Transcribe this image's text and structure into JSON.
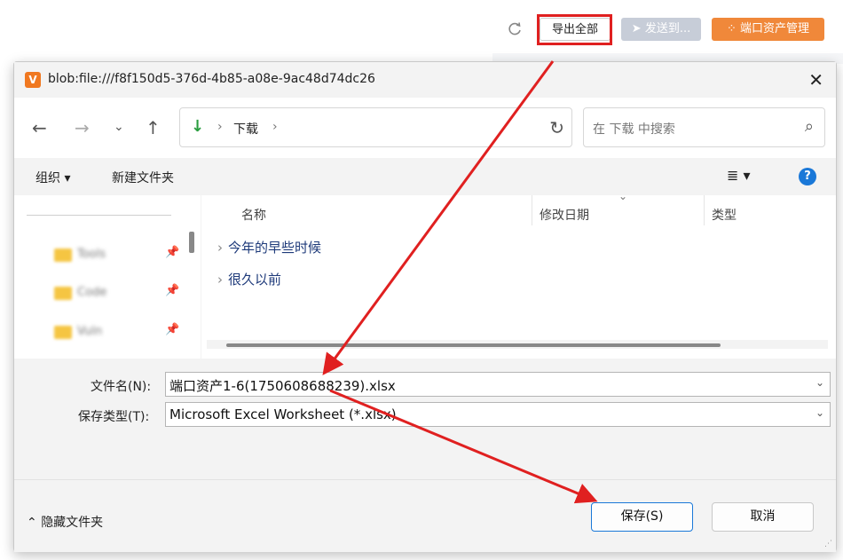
{
  "toolbar": {
    "export_all": "导出全部",
    "send_to": "发送到...",
    "port_asset_mgmt": "端口资产管理"
  },
  "dialog": {
    "title": "blob:file:///f8f150d5-376d-4b85-a08e-9ac48d74dc26",
    "breadcrumb": "下载",
    "search_placeholder": "在 下载 中搜索",
    "commands": {
      "organize": "组织 ▾",
      "new_folder": "新建文件夹"
    },
    "columns": {
      "name": "名称",
      "date": "修改日期",
      "type": "类型"
    },
    "groups": [
      "今年的早些时候",
      "很久以前"
    ],
    "quick_access": [
      "Tools",
      "Code",
      "Vuln"
    ],
    "filename_label": "文件名(N):",
    "filename_value": "端口资产1-6(1750608688239).xlsx",
    "filetype_label": "保存类型(T):",
    "filetype_value": "Microsoft Excel Worksheet (*.xlsx)",
    "hide_folders": "隐藏文件夹",
    "save_button": "保存(S)",
    "cancel_button": "取消"
  },
  "colors": {
    "annotation_red": "#e02020",
    "accent_blue": "#1a78d8",
    "orange": "#f0883a"
  }
}
